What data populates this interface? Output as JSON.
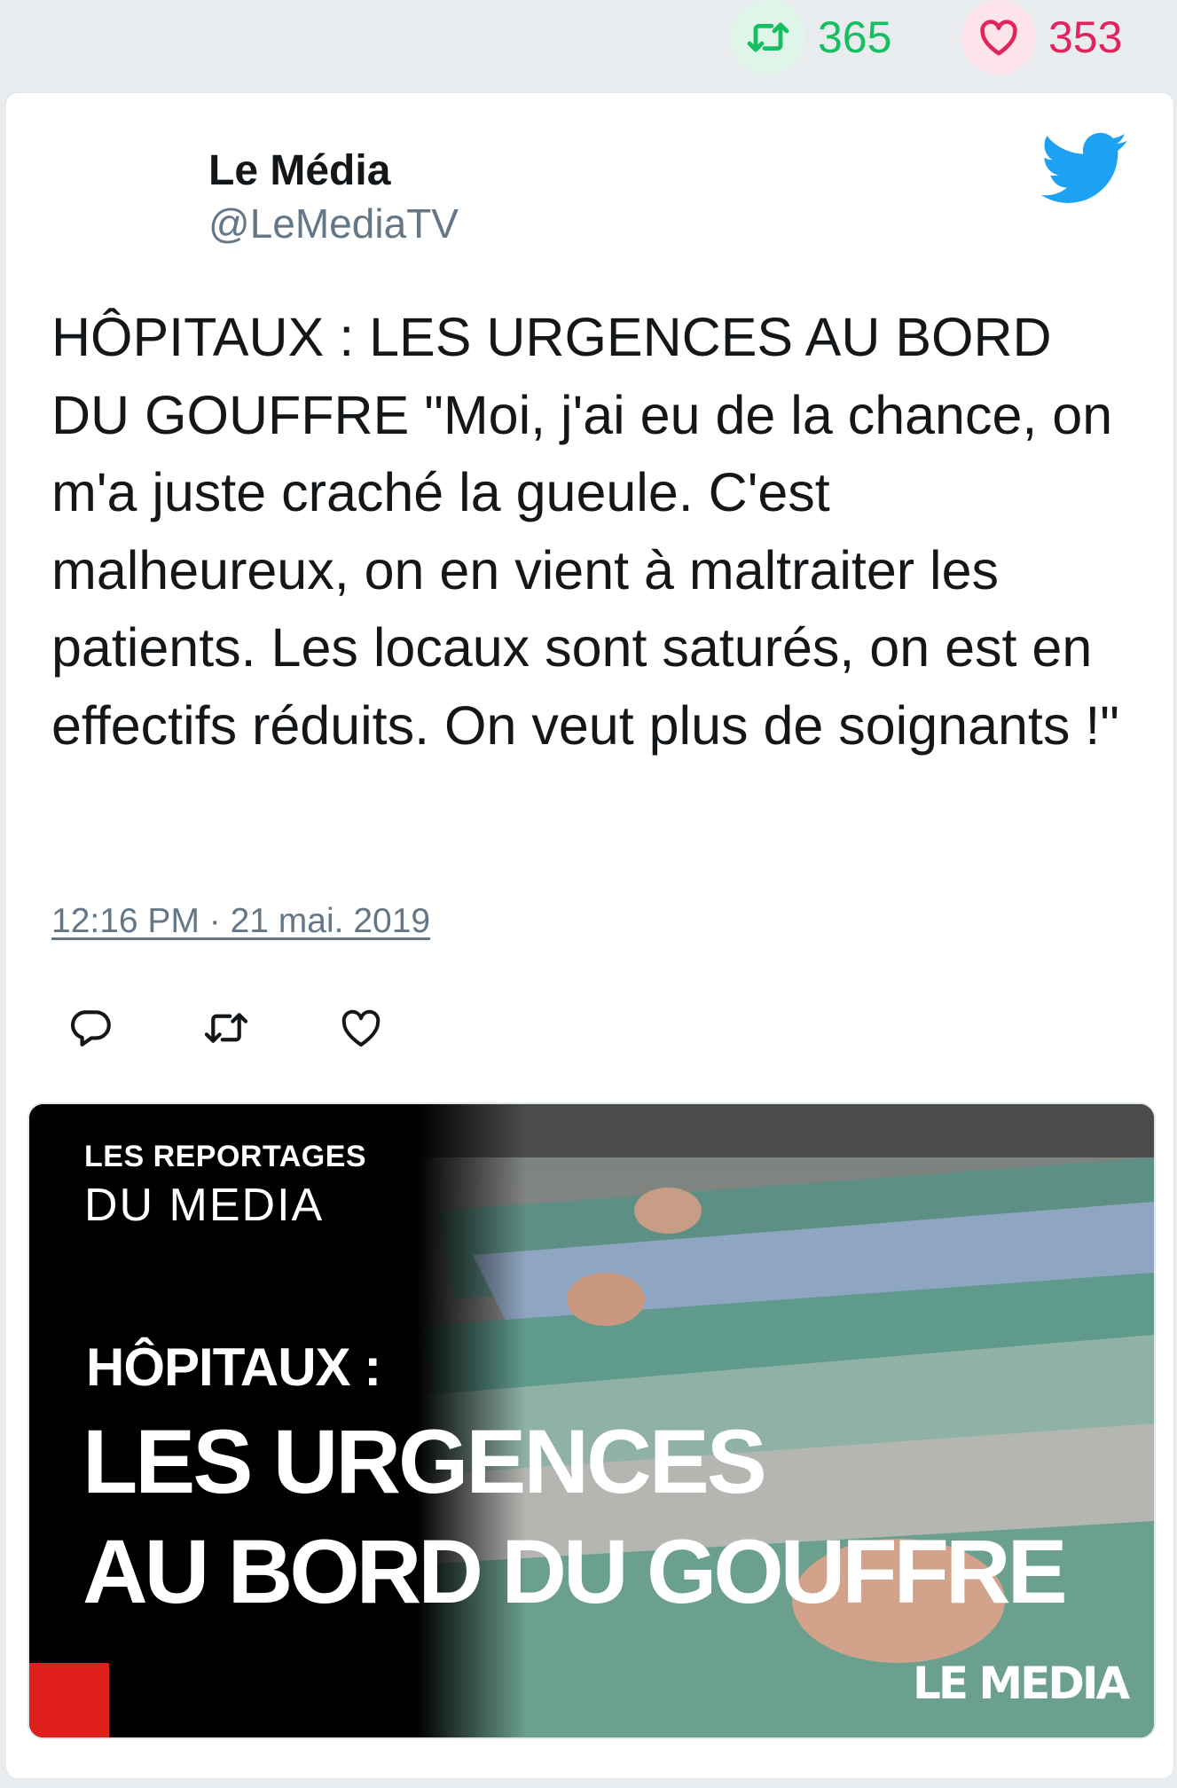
{
  "top_stats": {
    "retweet_count": "365",
    "like_count": "353",
    "retweet_color": "#17bf63",
    "like_color": "#e0245e"
  },
  "tweet": {
    "author_name": "Le Média",
    "author_handle": "@LeMediaTV",
    "text": "HÔPITAUX : LES URGENCES AU BORD DU GOUFFRE \"Moi, j'ai eu de la chance, on m'a juste craché la gueule. C'est malheureux, on en vient à maltraiter les patients. Les locaux sont saturés, on est en effectifs réduits. On veut plus de soignants !\"",
    "timestamp": "12:16 PM · 21 mai. 2019",
    "icons": {
      "brand": "twitter-bird-icon",
      "reply": "reply-icon",
      "retweet": "retweet-icon",
      "like": "heart-icon"
    }
  },
  "media": {
    "series_line1": "LES REPORTAGES",
    "series_line2": "DU MEDIA",
    "kicker": "HÔPITAUX :",
    "title_line1": "LES URGENCES",
    "title_line2": "AU BORD DU GOUFFRE",
    "logo_text": "LE MEDIA",
    "accent_color": "#e0201b"
  }
}
